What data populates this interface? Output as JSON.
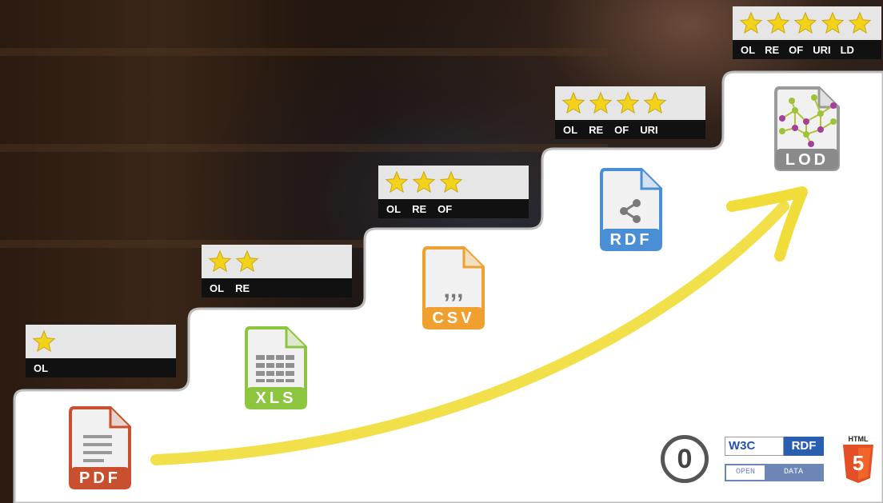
{
  "levels": [
    {
      "stars": 1,
      "labels": [
        "OL"
      ]
    },
    {
      "stars": 2,
      "labels": [
        "OL",
        "RE"
      ]
    },
    {
      "stars": 3,
      "labels": [
        "OL",
        "RE",
        "OF"
      ]
    },
    {
      "stars": 4,
      "labels": [
        "OL",
        "RE",
        "OF",
        "URI"
      ]
    },
    {
      "stars": 5,
      "labels": [
        "OL",
        "RE",
        "OF",
        "URI",
        "LD"
      ]
    }
  ],
  "formats": [
    {
      "name": "PDF",
      "color": "#c8502e"
    },
    {
      "name": "XLS",
      "color": "#8cc63f"
    },
    {
      "name": "CSV",
      "color": "#f0a030"
    },
    {
      "name": "RDF",
      "color": "#4a8fd6"
    },
    {
      "name": "LOD",
      "color": "#8a8a8a"
    }
  ],
  "logos": {
    "w3c": "W3C",
    "rdf": "RDF",
    "open": "OPEN",
    "data": "DATA",
    "html": "HTML",
    "html_num": "5",
    "cc0": "0"
  },
  "colors": {
    "star": "#f2d21b",
    "arrow": "#f0dd3a"
  }
}
